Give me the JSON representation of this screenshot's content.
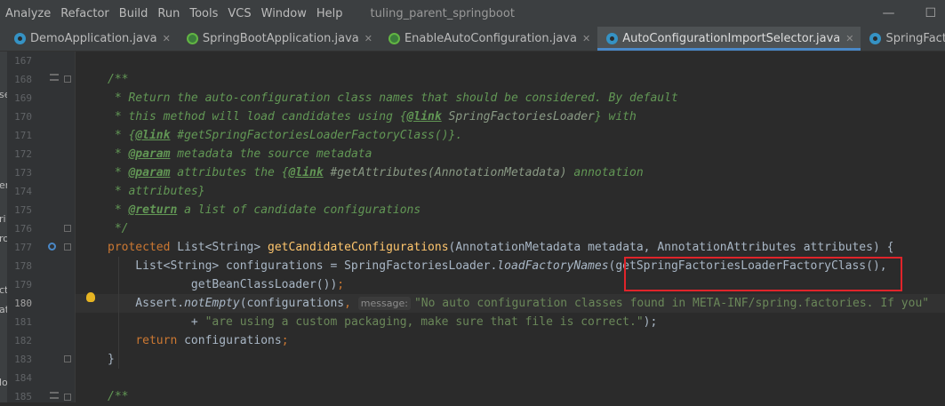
{
  "menubar": {
    "items": [
      "Analyze",
      "Refactor",
      "Build",
      "Run",
      "Tools",
      "VCS",
      "Window",
      "Help"
    ],
    "project_title": "tuling_parent_springboot",
    "minimize": "—",
    "maximize": "☐"
  },
  "tabs": [
    {
      "label": "DemoApplication.java",
      "icon": "class-icon",
      "close": "✕"
    },
    {
      "label": "SpringBootApplication.java",
      "icon": "spring-annotation-icon",
      "close": "✕"
    },
    {
      "label": "EnableAutoConfiguration.java",
      "icon": "spring-annotation-icon",
      "close": "✕"
    },
    {
      "label": "AutoConfigurationImportSelector.java",
      "icon": "class-icon",
      "close": "✕",
      "active": true
    },
    {
      "label": "SpringFactoriesLoader.java",
      "icon": "class-icon",
      "close": ""
    }
  ],
  "left_strip": [
    "se",
    "er",
    "ri",
    "ro",
    "ct",
    "at",
    "lo"
  ],
  "editor": {
    "line_numbers": [
      "167",
      "168",
      "169",
      "170",
      "171",
      "172",
      "173",
      "174",
      "175",
      "176",
      "177",
      "178",
      "179",
      "180",
      "181",
      "182",
      "183",
      "184",
      "185"
    ],
    "current_line": "180",
    "param_hint": "message:",
    "lines": {
      "l168": "/**",
      "l169": " * Return the auto-configuration class names that should be considered. By default",
      "l170a": " * this method will load candidates using {",
      "l170b": "@link",
      "l170c": " SpringFactoriesLoader",
      "l170d": "} with",
      "l171a": " * {",
      "l171b": "@link",
      "l171c": " #getSpringFactoriesLoaderFactoryClass()",
      "l171d": "}.",
      "l172a": " * ",
      "l172b": "@param",
      "l172c": " metadata the source metadata",
      "l173a": " * ",
      "l173b": "@param",
      "l173c": " attributes the {",
      "l173d": "@link",
      "l173e": " #getAttributes(AnnotationMetadata)",
      "l173f": " annotation",
      "l174": " * attributes}",
      "l175a": " * ",
      "l175b": "@return",
      "l175c": " a list of candidate configurations",
      "l176": " */",
      "l177a": "protected",
      "l177b": " List<String> ",
      "l177c": "getCandidateConfigurations",
      "l177d": "(AnnotationMetadata metadata, AnnotationAttributes attributes) {",
      "l178a": "    List<String> configurations = SpringFactoriesLoader.",
      "l178b": "loadFactoryNames",
      "l178c": "(getSpringFactoriesLoaderFactoryClass(),",
      "l179a": "            getBeanClassLoader())",
      "l179b": ";",
      "l180a": "    Assert.",
      "l180b": "notEmpty",
      "l180c": "(configurations",
      "l180d": ", ",
      "l180e": "\"No auto configuration classes found in META-INF/spring.factories. If you\"",
      "l181a": "            + ",
      "l181b": "\"are using a custom packaging, make sure that file is correct.\"",
      "l181c": ");",
      "l182a": "    ",
      "l182b": "return",
      "l182c": " configurations",
      "l182d": ";",
      "l183": "}",
      "l185": "/**"
    }
  },
  "colors": {
    "background": "#2b2b2b",
    "keyword": "#cc7832",
    "method": "#ffc66d",
    "string": "#6a8759",
    "doc": "#629755",
    "highlight_box": "#e0242a"
  }
}
